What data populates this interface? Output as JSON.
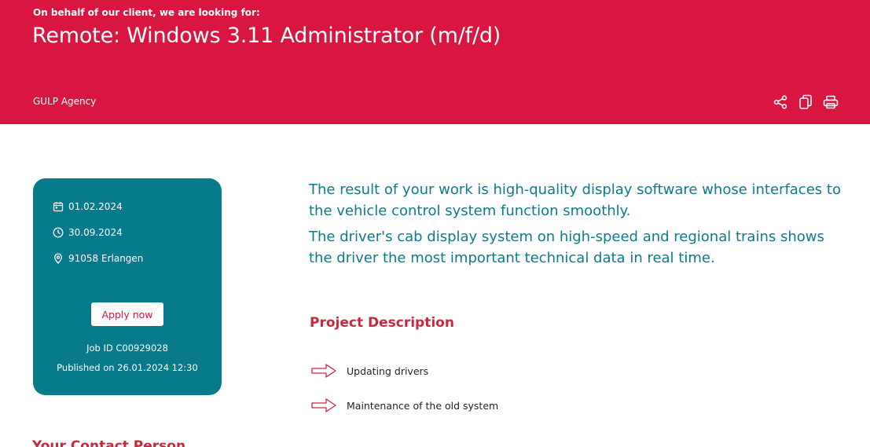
{
  "header": {
    "eyebrow": "On behalf of our client, we are looking for:",
    "title": "Remote: Windows 3.11 Administrator (m/f/d)",
    "agency": "GULP Agency",
    "actions": [
      {
        "name": "share",
        "icon": "share-icon"
      },
      {
        "name": "copy",
        "icon": "copy-icon"
      },
      {
        "name": "print",
        "icon": "print-icon"
      }
    ],
    "colors": {
      "banner": "#d91640",
      "text": "#ffffff"
    }
  },
  "sidebar_card": {
    "start_date": "01.02.2024",
    "end_date": "30.09.2024",
    "location": "91058 Erlangen",
    "apply_label": "Apply now",
    "job_id": "Job ID C00929028",
    "published": "Published on 26.01.2024 12:30",
    "colors": {
      "background": "#077a8c",
      "button_text": "#d91640"
    }
  },
  "main": {
    "intro_paragraphs": [
      "The result of your work is high-quality display software whose interfaces to the vehicle control system function smoothly.",
      "The driver's cab display system on high-speed and regional trains shows the driver the most important technical data in real time."
    ],
    "project_title": "Project Description",
    "project_items": [
      "Updating drivers",
      "Maintenance of the old system"
    ],
    "contact_title": "Your Contact Person",
    "colors": {
      "intro_text": "#0e7a8a",
      "section_title": "#c8283e"
    }
  }
}
